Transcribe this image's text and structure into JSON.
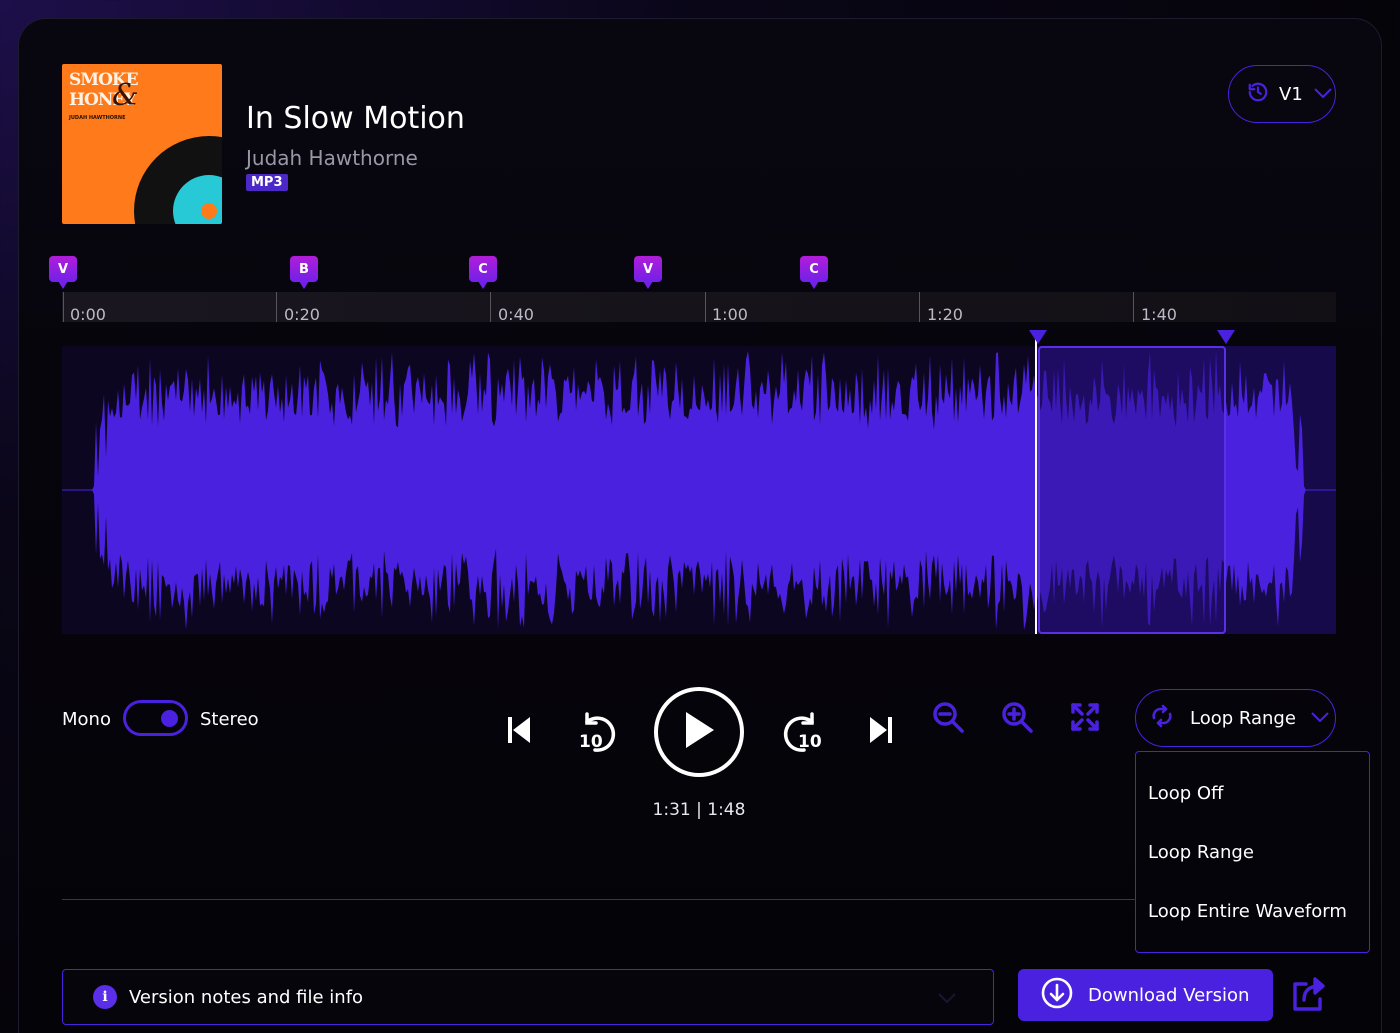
{
  "album": {
    "cover_title_line1": "SMOKE",
    "cover_title_line2": "HONEY",
    "cover_amp": "&",
    "cover_artist": "JUDAH HAWTHORNE"
  },
  "track": {
    "title": "In Slow Motion",
    "artist": "Judah Hawthorne",
    "format": "MP3"
  },
  "version_selector": {
    "label": "V1",
    "icon": "history-icon"
  },
  "markers": [
    {
      "label": "V",
      "time": "0:00"
    },
    {
      "label": "B",
      "time": "0:22"
    },
    {
      "label": "C",
      "time": "0:42"
    },
    {
      "label": "V",
      "time": "0:57"
    },
    {
      "label": "C",
      "time": "1:12"
    }
  ],
  "timeline": {
    "ticks": [
      "0:00",
      "0:20",
      "0:40",
      "1:00",
      "1:20",
      "1:40"
    ]
  },
  "waveform": {
    "duration_seconds": 108,
    "current_seconds": 91,
    "loop_start_seconds": 91,
    "loop_end_seconds": 108,
    "color": "#4b21e0"
  },
  "channel_toggle": {
    "left_label": "Mono",
    "right_label": "Stereo",
    "selected": "Stereo"
  },
  "transport": {
    "skip_back_icon": "skip-previous-icon",
    "rewind_label": "10",
    "play_icon": "play-icon",
    "forward_label": "10",
    "skip_forward_icon": "skip-next-icon",
    "current_time": "1:31",
    "separator": "|",
    "total_time": "1:48",
    "readout": "1:31 | 1:48"
  },
  "zoom": {
    "zoom_out_icon": "zoom-out-icon",
    "zoom_in_icon": "zoom-in-icon",
    "fit_icon": "fit-to-screen-icon"
  },
  "loop": {
    "selected": "Loop Range",
    "options": [
      "Loop Off",
      "Loop Range",
      "Loop Entire Waveform"
    ]
  },
  "footer": {
    "notes_label": "Version notes and file info",
    "info_icon": "info-icon",
    "download_label": "Download Version",
    "download_icon": "download-icon",
    "share_icon": "share-icon"
  },
  "colors": {
    "accent": "#4b21e0",
    "marker_top": "#b11dd8",
    "marker_bottom": "#7121e8",
    "background": "#050409"
  }
}
